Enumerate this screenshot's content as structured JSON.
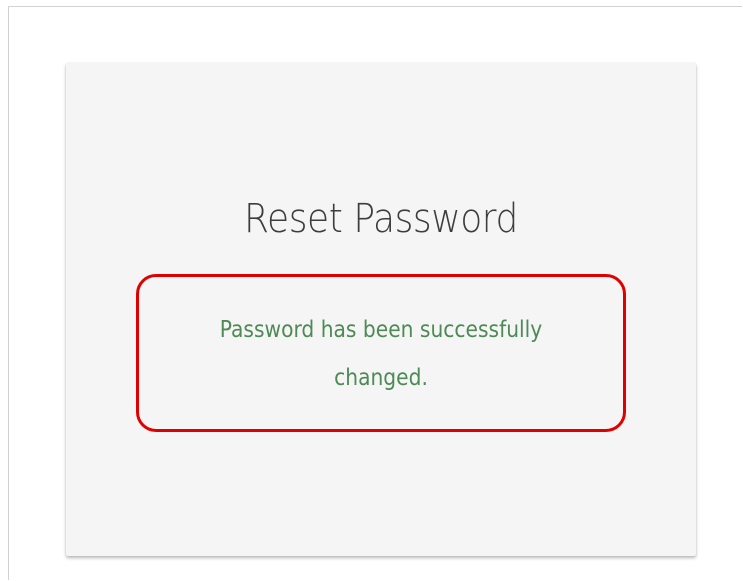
{
  "card": {
    "title": "Reset Password",
    "message": "Password has been successfully changed."
  },
  "colors": {
    "card_background": "#f5f5f5",
    "success_text": "#4e8a55",
    "highlight_border": "#e00000"
  }
}
